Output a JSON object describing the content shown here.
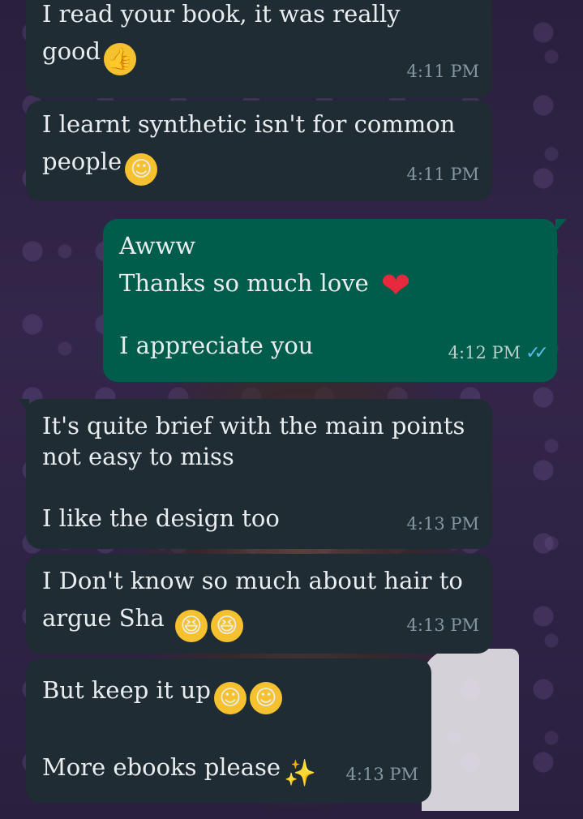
{
  "messages": [
    {
      "dir": "in",
      "lines": [
        "I read your book, it was really",
        "good"
      ],
      "emoji_after": "thumbs-up",
      "time": "4:11 PM"
    },
    {
      "dir": "in",
      "lines": [
        "I learnt synthetic isn't for common",
        "people"
      ],
      "emoji_after": "face-with-hand-over-mouth",
      "time": "4:11 PM"
    },
    {
      "dir": "out",
      "lines": [
        "Awww",
        "Thanks so much love",
        "",
        "I appreciate you"
      ],
      "emoji_after": "red-heart",
      "time": "4:12 PM",
      "status": "read"
    },
    {
      "dir": "in",
      "lines": [
        "It's quite brief with the main points",
        "not easy to miss",
        "",
        "I like the design too"
      ],
      "time": "4:13 PM"
    },
    {
      "dir": "in",
      "lines": [
        "I Don't know so much about hair to",
        "argue Sha"
      ],
      "emoji_after": "rolling-on-floor-laughing x2",
      "time": "4:13 PM"
    },
    {
      "dir": "in",
      "lines": [
        "But keep it up",
        "",
        "More ebooks please"
      ],
      "emoji_after": "hugging-face x2, sparkles",
      "time": "4:13 PM"
    }
  ],
  "colors": {
    "incoming": "#1f2c34",
    "outgoing": "#005c4b",
    "text": "#e9edef",
    "timestamp": "#8696a0",
    "read_ticks": "#53bdeb"
  }
}
